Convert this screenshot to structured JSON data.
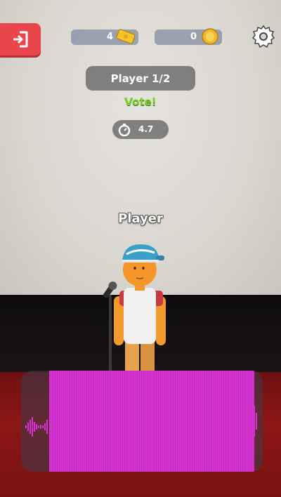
{
  "hud": {
    "tickets": "4",
    "coins": "0"
  },
  "round": {
    "player_label": "Player 1/2",
    "action_label": "Vote!",
    "timer_value": "4.7"
  },
  "performer": {
    "name": "Player"
  },
  "icons": {
    "exit": "exit-door-icon",
    "ticket": "ticket-icon",
    "coin": "coin-icon",
    "settings": "gear-icon",
    "timer": "stopwatch-icon"
  },
  "colors": {
    "exit_button": "#e8454d",
    "vote_text": "#7bd22e",
    "waveform": "#d633d1",
    "ticket": "#f2c531",
    "coin": "#f0b82a"
  }
}
